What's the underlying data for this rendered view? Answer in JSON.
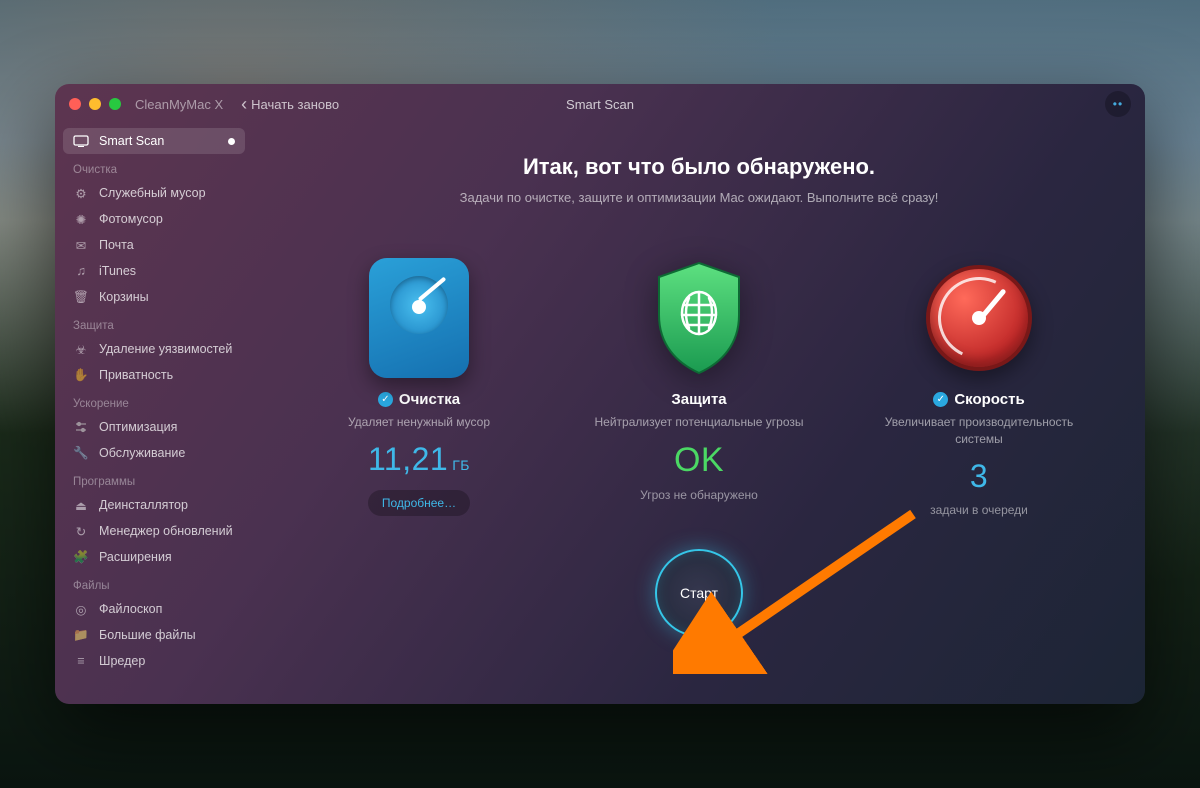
{
  "app_name": "CleanMyMac X",
  "window_title": "Smart Scan",
  "start_over": "Начать заново",
  "sidebar": {
    "smart_scan": "Smart Scan",
    "sections": {
      "cleanup": "Очистка",
      "protection": "Защита",
      "speed": "Ускорение",
      "apps": "Программы",
      "files": "Файлы"
    },
    "items": {
      "system_junk": "Служебный мусор",
      "photo_junk": "Фотомусор",
      "mail": "Почта",
      "itunes": "iTunes",
      "trash": "Корзины",
      "malware": "Удаление уязвимостей",
      "privacy": "Приватность",
      "optimization": "Оптимизация",
      "maintenance": "Обслуживание",
      "uninstaller": "Деинсталлятор",
      "updater": "Менеджер обновлений",
      "extensions": "Расширения",
      "space_lens": "Файлоскоп",
      "large_files": "Большие файлы",
      "shredder": "Шредер"
    }
  },
  "main": {
    "headline": "Итак, вот что было обнаружено.",
    "subline": "Задачи по очистке, защите и оптимизации Mac ожидают. Выполните всё сразу!",
    "cleanup": {
      "title": "Очистка",
      "desc": "Удаляет ненужный мусор",
      "value": "11,21",
      "unit": "ГБ",
      "details": "Подробнее…"
    },
    "protection": {
      "title": "Защита",
      "desc": "Нейтрализует потенциальные угрозы",
      "value": "OK",
      "sub": "Угроз не обнаружено"
    },
    "speed": {
      "title": "Скорость",
      "desc": "Увеличивает производительность системы",
      "value": "3",
      "sub": "задачи в очереди"
    },
    "start_button": "Старт"
  }
}
